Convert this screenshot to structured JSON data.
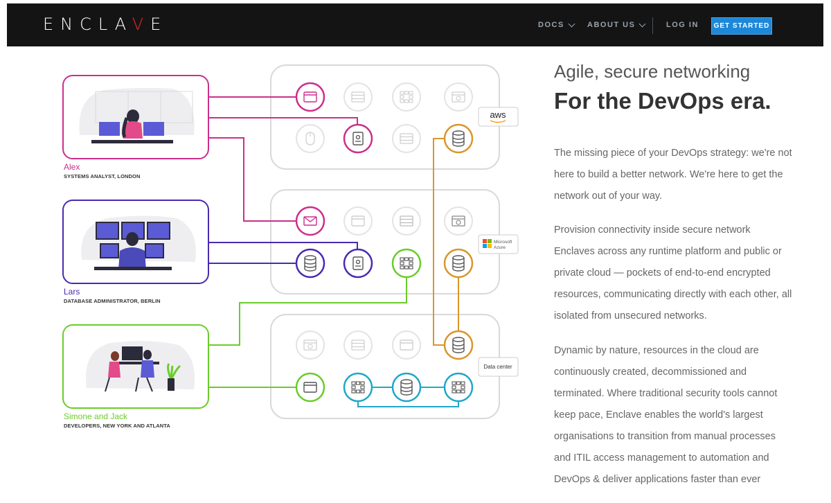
{
  "nav": {
    "logo_pre": "ENCLA",
    "logo_accent": "V",
    "logo_post": "E",
    "docs": "DOCS",
    "about": "ABOUT US",
    "login": "LOG IN",
    "cta": "GET STARTED"
  },
  "diagram": {
    "people": [
      {
        "name": "Alex",
        "role": "SYSTEMS ANALYST, LONDON",
        "color": "#cc2e8c"
      },
      {
        "name": "Lars",
        "role": "DATABASE ADMINISTRATOR, BERLIN",
        "color": "#4a2ab0"
      },
      {
        "name": "Simone and Jack",
        "role": "DEVELOPERS, NEW YORK AND ATLANTA",
        "color": "#6acc2a"
      }
    ],
    "clouds": {
      "aws": "aws",
      "azure_line1": "Microsoft",
      "azure_line2": "Azure",
      "datacenter": "Data center"
    },
    "colors": {
      "magenta": "#cc2e8c",
      "purple": "#4a2ab0",
      "green": "#6acc2a",
      "orange": "#d9962a",
      "cyan": "#1fa7c9",
      "grey": "#d4d4d4"
    }
  },
  "content": {
    "tagline": "Agile, secure networking",
    "headline": "For the DevOps era.",
    "para1": "The missing piece of your DevOps strategy: we're not here to build a better network. We're here to get the network out of your way.",
    "para2": "Provision connectivity inside secure network Enclaves across any runtime platform and public or private cloud — pockets of end-to-end encrypted resources, communicating directly with each other, all isolated from unsecured networks.",
    "para3": "Dynamic by nature, resources in the cloud are continuously created, decommissioned and terminated. Where traditional security tools cannot keep pace, Enclave enables the world's largest organisations to transition from manual processes and ITIL access management to automation and DevOps & deliver applications faster than ever"
  }
}
